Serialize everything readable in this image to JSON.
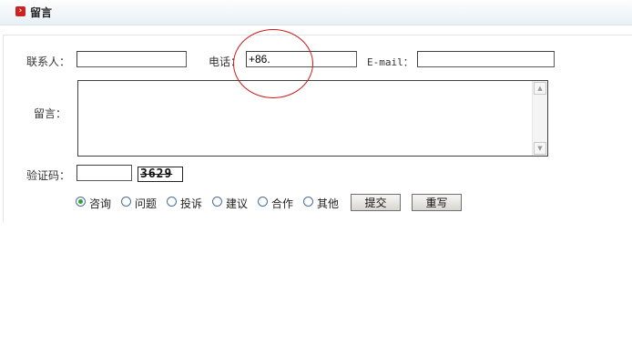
{
  "header": {
    "title": "留言",
    "icon": "chevron-right-icon",
    "icon_glyph": "›"
  },
  "form": {
    "contact_label": "联系人：",
    "contact_value": "",
    "phone_label": "电话：",
    "phone_value": "+86.",
    "email_label": "E-mail：",
    "email_value": "",
    "message_label": "留言：",
    "message_value": "",
    "captcha_label": "验证码：",
    "captcha_value": "",
    "captcha_image_text": "3629",
    "scroll_up_icon": "▲",
    "scroll_down_icon": "▼"
  },
  "categories": {
    "selected": "咨询",
    "options": [
      "咨询",
      "问题",
      "投诉",
      "建议",
      "合作",
      "其他"
    ]
  },
  "buttons": {
    "submit": "提交",
    "reset": "重写"
  },
  "colors": {
    "annotation_circle": "#d11a1a",
    "header_icon": "#cc2222"
  }
}
